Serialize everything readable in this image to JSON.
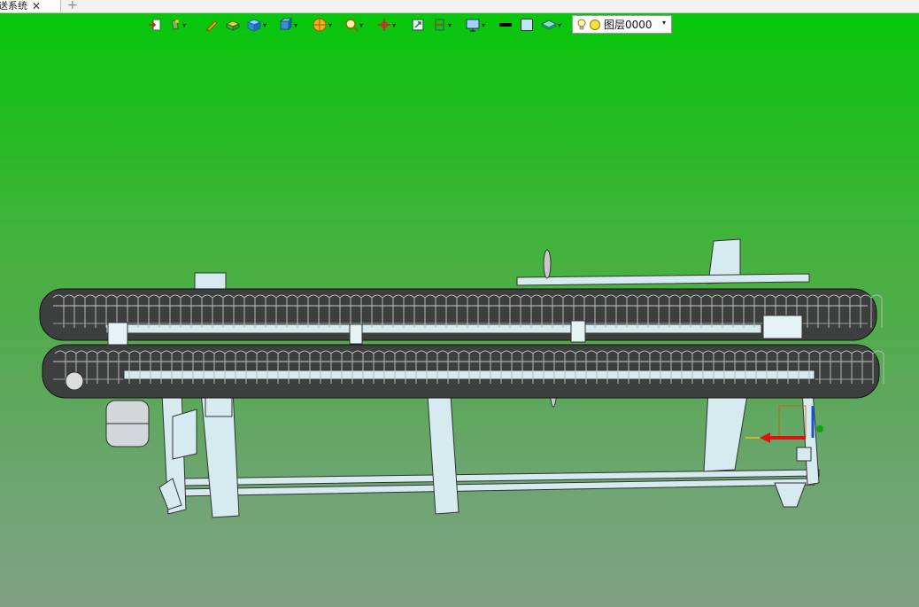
{
  "tab": {
    "title": "送系统",
    "close_glyph": "✕",
    "new_tab_glyph": "+"
  },
  "toolbar": {
    "tools": [
      {
        "name": "import-icon",
        "dropdown": false
      },
      {
        "name": "light-icon",
        "dropdown": true
      },
      {
        "name": "pen-icon",
        "dropdown": false
      },
      {
        "name": "box-solid-icon",
        "dropdown": false
      },
      {
        "name": "cube-icon",
        "dropdown": true
      },
      {
        "name": "view-cube-icon",
        "dropdown": true
      },
      {
        "name": "render-sphere-icon",
        "dropdown": true
      },
      {
        "name": "zoom-icon",
        "dropdown": true
      },
      {
        "name": "pan-icon",
        "dropdown": true
      },
      {
        "name": "fit-view-icon",
        "dropdown": false
      },
      {
        "name": "section-icon",
        "dropdown": true
      },
      {
        "name": "display-monitor-icon",
        "dropdown": true
      },
      {
        "name": "line-color-icon",
        "dropdown": false
      },
      {
        "name": "fill-color-icon",
        "dropdown": false
      },
      {
        "name": "layer-style-icon",
        "dropdown": true
      }
    ],
    "layer": {
      "name": "图层0000",
      "arrow": "▾"
    }
  },
  "colors": {
    "background_top": "#06c70a",
    "background_bottom": "#82a182",
    "frame": "#d8ecf0",
    "chain": "#3a3a3a",
    "axis_x": "#e01010",
    "axis_z": "#2050d0",
    "axis_y": "#10a010"
  }
}
